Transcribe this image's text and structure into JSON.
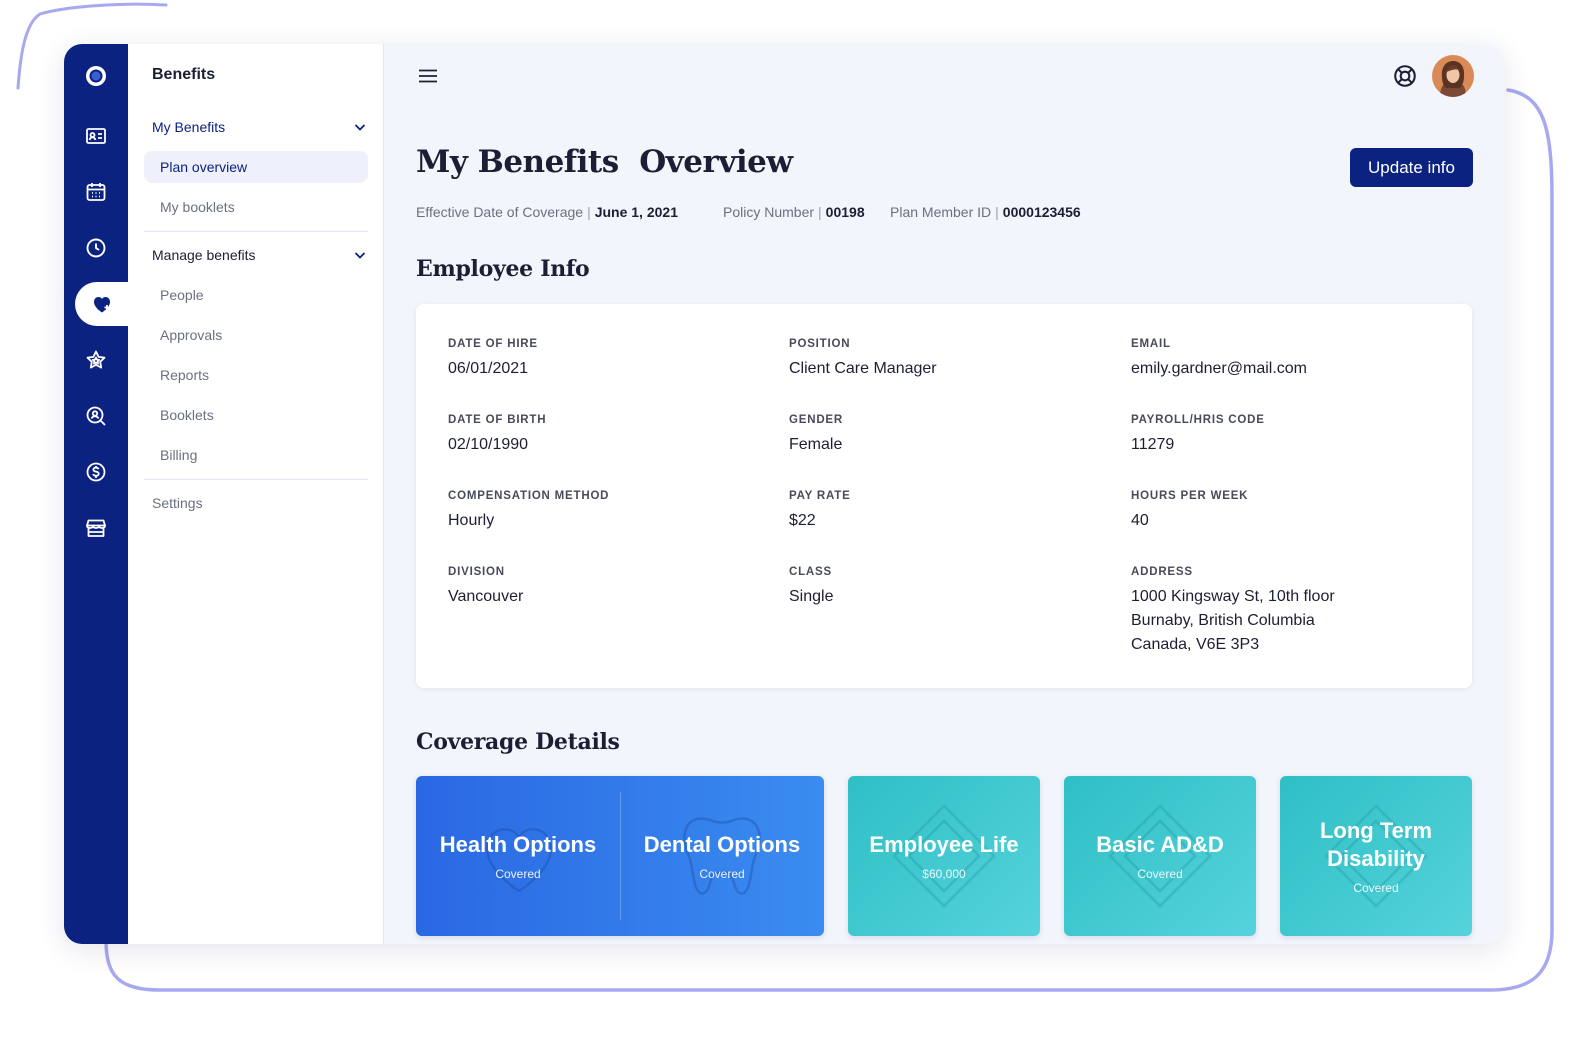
{
  "sidebar": {
    "title": "Benefits",
    "groups": [
      {
        "label": "My Benefits",
        "items": [
          "Plan overview",
          "My booklets"
        ]
      },
      {
        "label": "Manage benefits",
        "items": [
          "People",
          "Approvals",
          "Reports",
          "Booklets",
          "Billing"
        ]
      }
    ],
    "settings": "Settings",
    "active_item": "Plan overview"
  },
  "header": {
    "title": "My Benefits  Overview",
    "update_button": "Update info",
    "meta": [
      {
        "label": "Effective Date of Coverage",
        "value": "June 1, 2021"
      },
      {
        "label": "Policy Number",
        "value": "00198"
      },
      {
        "label": "Plan Member ID",
        "value": "0000123456"
      }
    ]
  },
  "employee_info": {
    "title": "Employee Info",
    "fields": [
      {
        "label": "DATE OF HIRE",
        "value": "06/01/2021"
      },
      {
        "label": "POSITION",
        "value": "Client Care Manager"
      },
      {
        "label": "EMAIL",
        "value": "emily.gardner@mail.com"
      },
      {
        "label": "DATE OF BIRTH",
        "value": "02/10/1990"
      },
      {
        "label": "GENDER",
        "value": "Female"
      },
      {
        "label": "PAYROLL/HRIS CODE",
        "value": "11279"
      },
      {
        "label": "COMPENSATION METHOD",
        "value": "Hourly"
      },
      {
        "label": "PAY RATE",
        "value": "$22"
      },
      {
        "label": "HOURS PER WEEK",
        "value": "40"
      },
      {
        "label": "DIVISION",
        "value": "Vancouver"
      },
      {
        "label": "CLASS",
        "value": "Single"
      },
      {
        "label": "ADDRESS",
        "value_lines": [
          "1000 Kingsway St, 10th floor",
          "Burnaby, British Columbia",
          "Canada, V6E 3P3"
        ]
      }
    ]
  },
  "coverage": {
    "title": "Coverage Details",
    "cards": [
      {
        "title": "Health Options",
        "sub": "Covered"
      },
      {
        "title": "Dental Options",
        "sub": "Covered"
      },
      {
        "title": "Employee Life",
        "sub": "$60,000"
      },
      {
        "title": "Basic AD&D",
        "sub": "Covered"
      },
      {
        "title_lines": [
          "Long Term",
          "Disability"
        ],
        "sub": "Covered"
      }
    ]
  },
  "icons": {
    "rail": [
      "logo-icon",
      "id-card-icon",
      "calendar-icon",
      "clock-icon",
      "heart-plus-icon",
      "star-icon",
      "search-user-icon",
      "dollar-icon",
      "store-icon"
    ],
    "active_rail": "heart-plus-icon"
  },
  "colors": {
    "brand_navy": "#0c2280",
    "health_blue": "#2a68e3",
    "coverage_teal": "#2ebfc5",
    "page_bg": "#f2f5fc"
  }
}
